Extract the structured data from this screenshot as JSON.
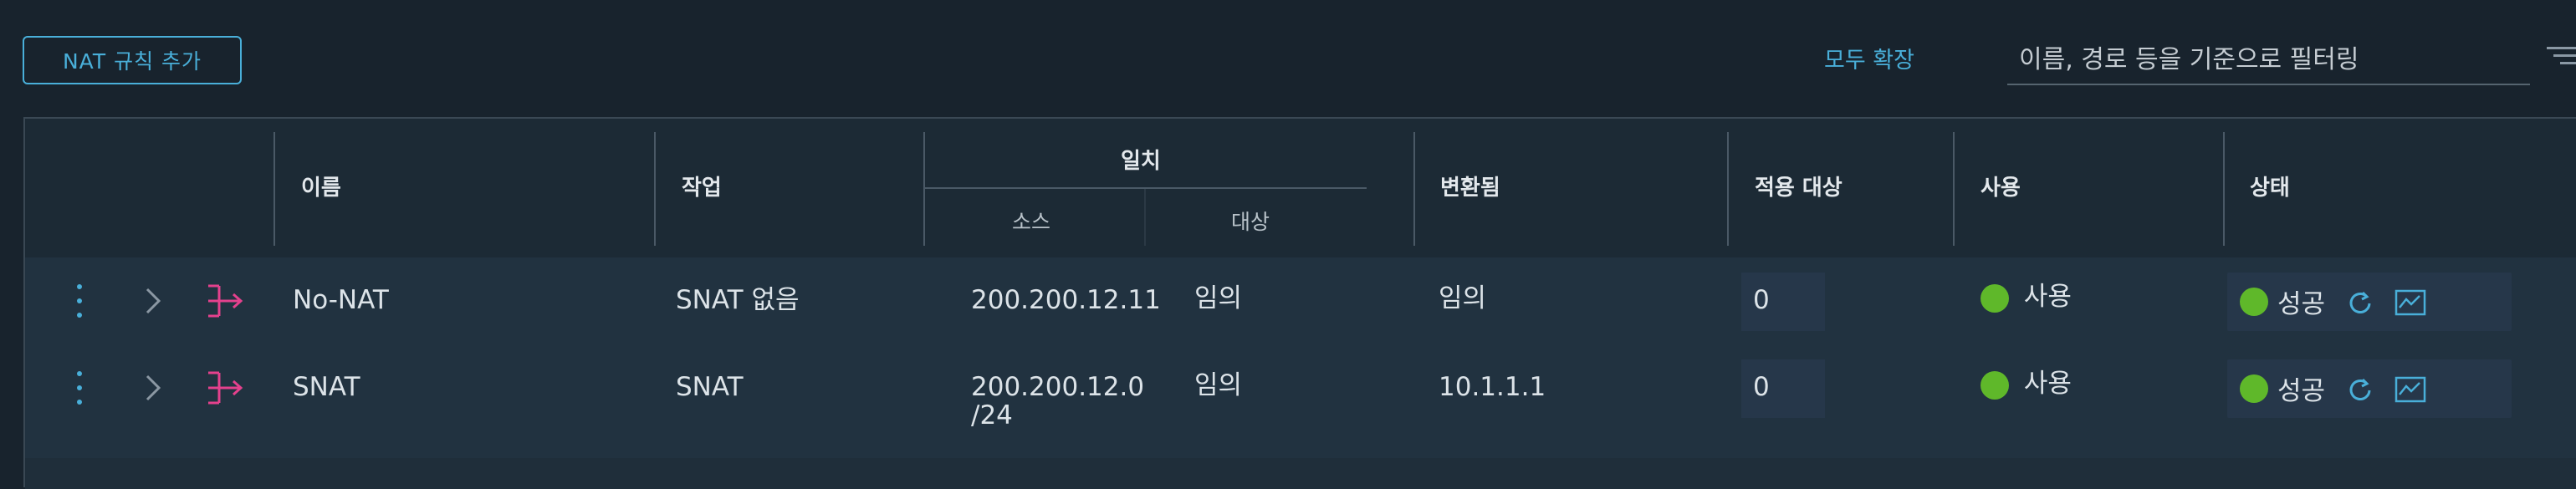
{
  "toolbar": {
    "add_label": "NAT 규칙 추가",
    "expand_all": "모두 확장",
    "filter_placeholder": "이름, 경로 등을 기준으로 필터링"
  },
  "columns": {
    "name": "이름",
    "action": "작업",
    "match": "일치",
    "source": "소스",
    "destination": "대상",
    "translated": "변환됨",
    "applied_to": "적용 대상",
    "enabled": "사용",
    "status": "상태"
  },
  "rows": [
    {
      "name": "No-NAT",
      "action": "SNAT 없음",
      "source": "200.200.12.11",
      "destination": "임의",
      "translated": "임의",
      "applied_to": "0",
      "enabled": "사용",
      "status": "성공"
    },
    {
      "name": "SNAT",
      "action": "SNAT",
      "source_line1": "200.200.12.0",
      "source_line2": "/24",
      "destination": "임의",
      "translated": "10.1.1.1",
      "applied_to": "0",
      "enabled": "사용",
      "status": "성공"
    }
  ],
  "colors": {
    "accent": "#49afd9",
    "success": "#5fb82a",
    "nat_icon": "#e4418d",
    "background": "#18232d"
  },
  "icons": [
    "kebab-icon",
    "chevron-right-icon",
    "nat-rule-icon",
    "refresh-icon",
    "chart-icon",
    "filter-icon"
  ]
}
